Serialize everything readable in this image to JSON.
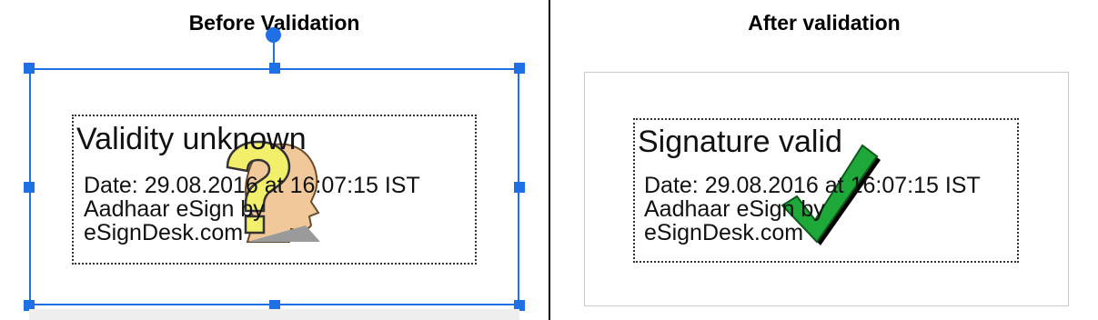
{
  "left": {
    "title": "Before Validation",
    "signature": {
      "status": "Validity unknown",
      "date": "Date: 29.08.2016 at 16:07:15 IST",
      "signer_line1": "Aadhaar eSign by",
      "signer_line2": "eSignDesk.com"
    },
    "icon": "question-mark-head-icon"
  },
  "right": {
    "title": "After validation",
    "signature": {
      "status": "Signature valid",
      "date": "Date: 29.08.2016 at 16:07:15 IST",
      "signer_line1": "Aadhaar eSign by",
      "signer_line2": "eSignDesk.com"
    },
    "icon": "green-checkmark-icon"
  },
  "colors": {
    "selection": "#1f6fe5",
    "checkmark": "#1fa83a",
    "question_mark": "#f2f06a",
    "head": "#f0c89a"
  }
}
